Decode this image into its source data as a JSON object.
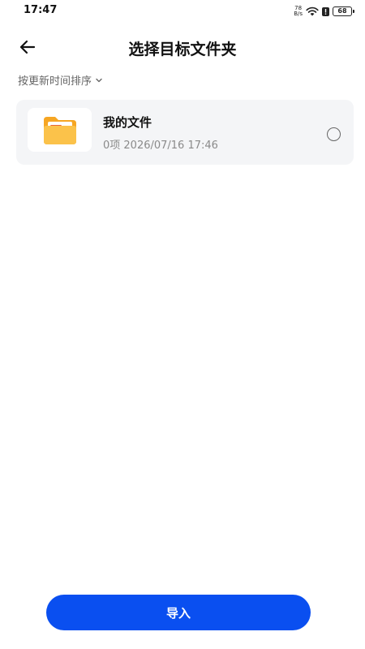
{
  "status_bar": {
    "time": "17:47",
    "net_speed_value": "78",
    "net_speed_unit": "B/s",
    "battery": "68"
  },
  "header": {
    "title": "选择目标文件夹"
  },
  "sort": {
    "label": "按更新时间排序"
  },
  "folders": [
    {
      "name": "我的文件",
      "meta": "0项 2026/07/16 17:46",
      "selected": false
    }
  ],
  "footer": {
    "import_label": "导入"
  },
  "colors": {
    "primary": "#0a4ff0",
    "card_bg": "#f4f5f7",
    "folder_yellow": "#fbbf3c",
    "folder_accent": "#e8653a"
  }
}
